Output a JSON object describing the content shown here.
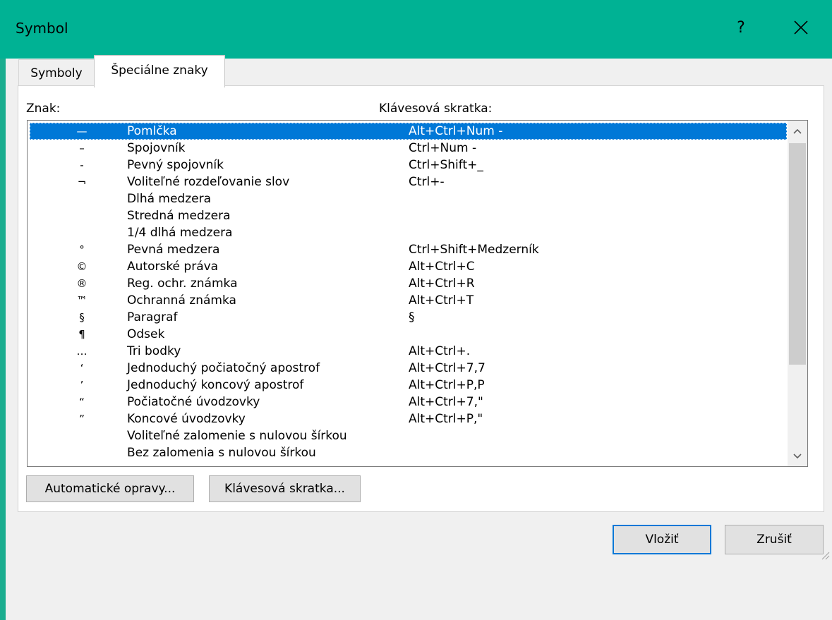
{
  "window": {
    "title": "Symbol",
    "help": "?"
  },
  "tabs": [
    {
      "label": "Symboly"
    },
    {
      "label": "Špeciálne znaky"
    }
  ],
  "columns": {
    "char": "Znak:",
    "shortcut": "Klávesová skratka:"
  },
  "rows": [
    {
      "char": "—",
      "name": "Pomlčka",
      "shortcut": "Alt+Ctrl+Num -"
    },
    {
      "char": "–",
      "name": "Spojovník",
      "shortcut": "Ctrl+Num -"
    },
    {
      "char": "-",
      "name": "Pevný spojovník",
      "shortcut": "Ctrl+Shift+_"
    },
    {
      "char": "¬",
      "name": "Voliteľné rozdeľovanie slov",
      "shortcut": "Ctrl+-"
    },
    {
      "char": "",
      "name": "Dlhá medzera",
      "shortcut": ""
    },
    {
      "char": "",
      "name": "Stredná medzera",
      "shortcut": ""
    },
    {
      "char": "",
      "name": "1/4 dlhá medzera",
      "shortcut": ""
    },
    {
      "char": "°",
      "name": "Pevná medzera",
      "shortcut": "Ctrl+Shift+Medzerník"
    },
    {
      "char": "©",
      "name": "Autorské práva",
      "shortcut": "Alt+Ctrl+C"
    },
    {
      "char": "®",
      "name": "Reg. ochr. známka",
      "shortcut": "Alt+Ctrl+R"
    },
    {
      "char": "™",
      "name": "Ochranná známka",
      "shortcut": "Alt+Ctrl+T"
    },
    {
      "char": "§",
      "name": "Paragraf",
      "shortcut": "§"
    },
    {
      "char": "¶",
      "name": "Odsek",
      "shortcut": ""
    },
    {
      "char": "…",
      "name": "Tri bodky",
      "shortcut": "Alt+Ctrl+."
    },
    {
      "char": "‘",
      "name": "Jednoduchý počiatočný apostrof",
      "shortcut": "Alt+Ctrl+7,7"
    },
    {
      "char": "’",
      "name": "Jednoduchý koncový apostrof",
      "shortcut": "Alt+Ctrl+P,P"
    },
    {
      "char": "“",
      "name": "Počiatočné úvodzovky",
      "shortcut": "Alt+Ctrl+7,\""
    },
    {
      "char": "”",
      "name": "Koncové úvodzovky",
      "shortcut": "Alt+Ctrl+P,\""
    },
    {
      "char": "",
      "name": "Voliteľné zalomenie s nulovou šírkou",
      "shortcut": ""
    },
    {
      "char": "",
      "name": "Bez zalomenia s nulovou šírkou",
      "shortcut": ""
    }
  ],
  "selected_index": 0,
  "scroll": {
    "thumb_fraction": 0.68,
    "position": 0
  },
  "buttons": {
    "autocorrect": "Automatické opravy...",
    "shortcut_key": "Klávesová skratka...",
    "insert": "Vložiť",
    "cancel": "Zrušiť"
  },
  "colors": {
    "title_bar": "#00b294",
    "selection": "#0078d7",
    "default_button_border": "#0078d7"
  },
  "icons": {
    "close": "close-icon",
    "scroll_up": "chevron-up-icon",
    "scroll_down": "chevron-down-icon",
    "grip": "resize-grip-icon"
  }
}
